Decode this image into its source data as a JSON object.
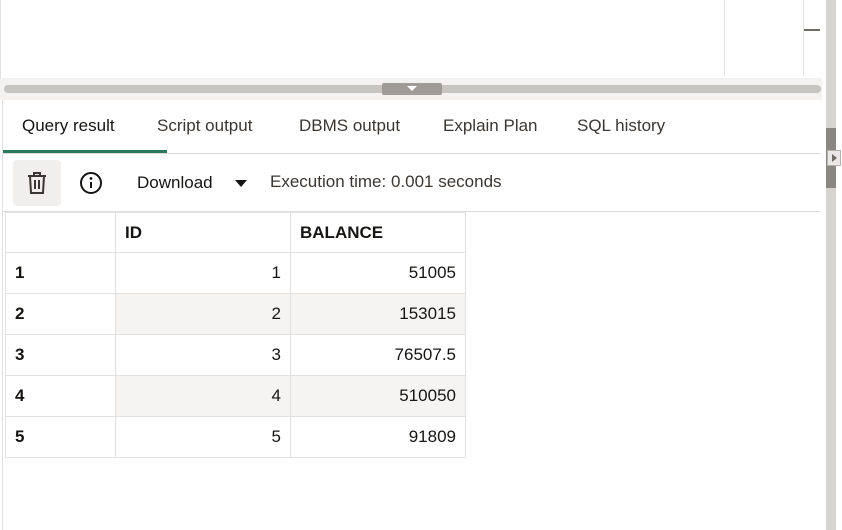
{
  "tabs": [
    {
      "label": "Query result",
      "active": true
    },
    {
      "label": "Script output",
      "active": false
    },
    {
      "label": "DBMS output",
      "active": false
    },
    {
      "label": "Explain Plan",
      "active": false
    },
    {
      "label": "SQL history",
      "active": false
    }
  ],
  "toolbar": {
    "trash_icon": "trash-icon",
    "info_icon": "info-icon",
    "download_label": "Download",
    "execution_time": "Execution time: 0.001 seconds"
  },
  "table": {
    "columns": [
      "ID",
      "BALANCE"
    ],
    "rows": [
      {
        "row": "1",
        "id": "1",
        "balance": "51005"
      },
      {
        "row": "2",
        "id": "2",
        "balance": "153015"
      },
      {
        "row": "3",
        "id": "3",
        "balance": "76507.5"
      },
      {
        "row": "4",
        "id": "4",
        "balance": "510050"
      },
      {
        "row": "5",
        "id": "5",
        "balance": "91809"
      }
    ]
  },
  "colors": {
    "active_tab_underline": "#2c7a5b",
    "alt_row_bg": "#f5f4f2"
  }
}
